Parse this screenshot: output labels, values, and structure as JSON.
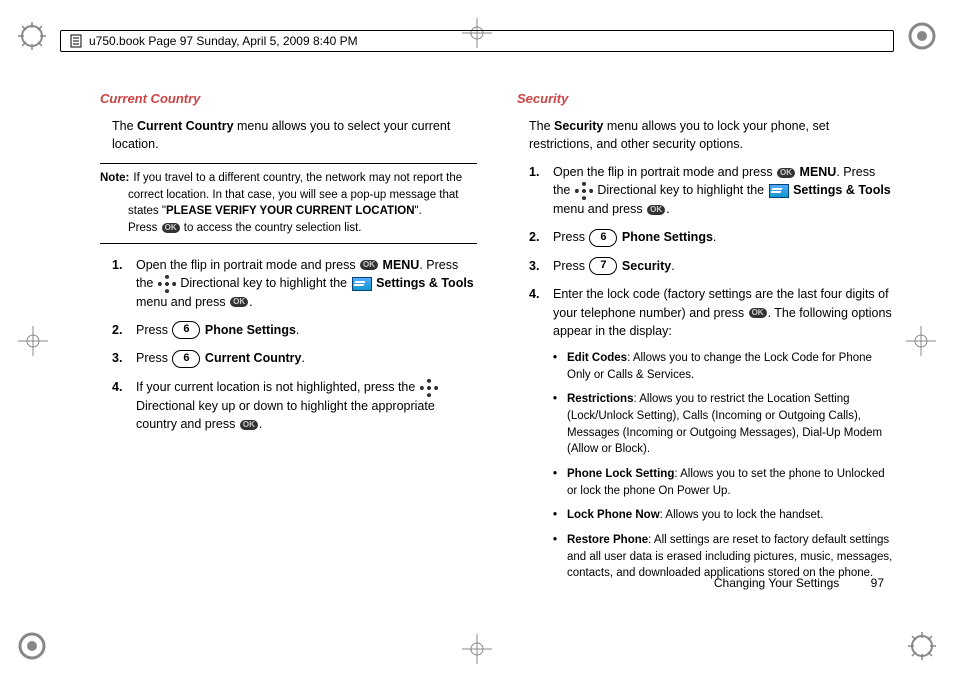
{
  "header": {
    "text": "u750.book  Page 97  Sunday, April 5, 2009  8:40 PM"
  },
  "footer": {
    "chapter": "Changing Your Settings",
    "page": "97"
  },
  "icons": {
    "ok": "OK"
  },
  "left": {
    "title": "Current Country",
    "intro_1": "The ",
    "intro_b": "Current Country",
    "intro_2": " menu allows you to select your current location.",
    "note_label": "Note:",
    "note_1": "If you travel to a different country, the network may not report the correct location. In that case, you will see a pop-up message that states \"",
    "note_b": "PLEASE VERIFY YOUR CURRENT LOCATION",
    "note_2": "\".",
    "note_3a": "Press ",
    "note_3b": " to access the country selection list.",
    "s1": {
      "n": "1.",
      "a": "Open the flip in portrait mode and press ",
      "menu": "MENU",
      "b": ". Press the ",
      "c": " Directional key to highlight the ",
      "st": "Settings & Tools",
      "d": " menu and press ",
      "e": "."
    },
    "s2": {
      "n": "2.",
      "a": "Press ",
      "k": "6",
      "b": "Phone Settings",
      "c": "."
    },
    "s3": {
      "n": "3.",
      "a": "Press ",
      "k": "6",
      "b": "Current Country",
      "c": "."
    },
    "s4": {
      "n": "4.",
      "a": "If your current location is not highlighted, press the ",
      "b": " Directional key up or down to highlight the appropriate country and press ",
      "c": "."
    }
  },
  "right": {
    "title": "Security",
    "intro_1": "The ",
    "intro_b": "Security",
    "intro_2": " menu allows you to lock your phone, set restrictions, and other security options.",
    "s1": {
      "n": "1.",
      "a": "Open the flip in portrait mode and press ",
      "menu": "MENU",
      "b": ". Press the ",
      "c": " Directional key to highlight the ",
      "st": "Settings & Tools",
      "d": " menu and press ",
      "e": "."
    },
    "s2": {
      "n": "2.",
      "a": "Press ",
      "k": "6",
      "b": "Phone Settings",
      "c": "."
    },
    "s3": {
      "n": "3.",
      "a": "Press ",
      "k": "7",
      "b": "Security",
      "c": "."
    },
    "s4": {
      "n": "4.",
      "a": "Enter the lock code (factory settings are the last four digits of your telephone number) and press ",
      "b": ". The following options appear in the display:"
    },
    "b1": {
      "t": "Edit Codes",
      "d": ": Allows you to change the Lock Code for Phone Only or Calls & Services."
    },
    "b2": {
      "t": "Restrictions",
      "d": ": Allows you to restrict the Location Setting (Lock/Unlock Setting), Calls (Incoming or Outgoing Calls), Messages (Incoming or Outgoing Messages), Dial-Up Modem (Allow or Block)."
    },
    "b3": {
      "t": "Phone Lock Setting",
      "d": ": Allows you to set the phone to Unlocked or lock the phone On Power Up."
    },
    "b4": {
      "t": "Lock Phone Now",
      "d": ": Allows you to lock the handset."
    },
    "b5": {
      "t": "Restore Phone",
      "d": ": All settings are reset to factory default settings and all user data is erased including pictures, music, messages, contacts, and downloaded applications stored on the phone."
    }
  }
}
